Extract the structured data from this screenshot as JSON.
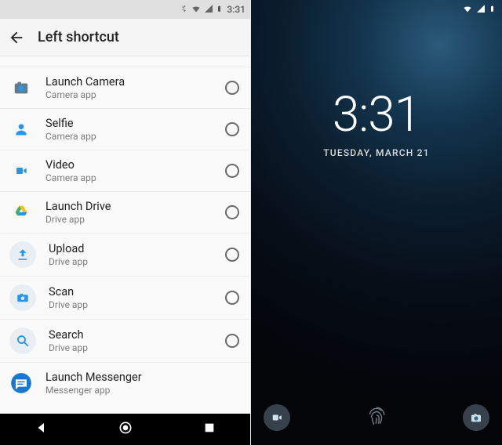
{
  "left": {
    "statusbar": {
      "time": "3:31"
    },
    "header": {
      "title": "Left shortcut"
    },
    "items": [
      {
        "title": "Launch Camera",
        "subtitle": "Camera app",
        "icon": "camera-icon"
      },
      {
        "title": "Selfie",
        "subtitle": "Camera app",
        "icon": "person-icon"
      },
      {
        "title": "Video",
        "subtitle": "Camera app",
        "icon": "videocam-icon"
      },
      {
        "title": "Launch Drive",
        "subtitle": "Drive app",
        "icon": "drive-icon"
      },
      {
        "title": "Upload",
        "subtitle": "Drive app",
        "icon": "upload-icon"
      },
      {
        "title": "Scan",
        "subtitle": "Drive app",
        "icon": "scan-icon"
      },
      {
        "title": "Search",
        "subtitle": "Drive app",
        "icon": "search-icon"
      },
      {
        "title": "Launch Messenger",
        "subtitle": "Messenger app",
        "icon": "messenger-icon"
      }
    ]
  },
  "right": {
    "statusbar": {},
    "clock": "3:31",
    "date_line": "TUESDAY, MARCH 21"
  }
}
